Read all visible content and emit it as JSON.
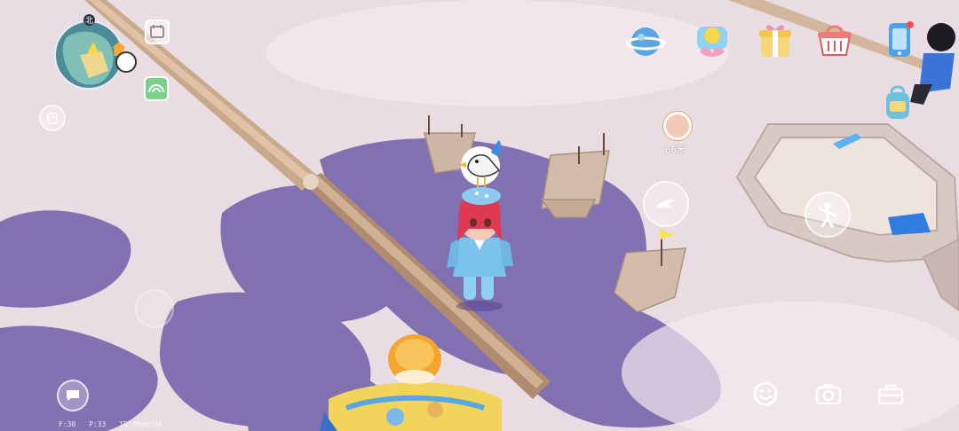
{
  "hud": {
    "minimap": {
      "north_label": "北"
    },
    "player_distance": "66米",
    "debug": {
      "f": "F:30",
      "p": "P:33",
      "id": "ID:fbsq?d4"
    }
  },
  "icons": {
    "top_row": [
      "planet-icon",
      "duck-gift-icon",
      "gift-box-icon",
      "shopping-basket-icon",
      "phone-icon"
    ],
    "left_column": [
      "album-icon",
      "rainbow-icon",
      "clipboard-icon",
      "joystick-icon",
      "chat-icon"
    ],
    "right_column": [
      "backpack-icon",
      "swim-action-icon",
      "dance-action-icon"
    ],
    "bottom_right": [
      "emoji-icon",
      "camera-icon",
      "toolbox-icon"
    ]
  },
  "colors": {
    "sand": "#e9dbe2",
    "shadow": "#6d5ea8",
    "sky_blue": "#5aa6e0",
    "character_hair": "#e03a52",
    "character_outfit": "#7cc3ec"
  }
}
